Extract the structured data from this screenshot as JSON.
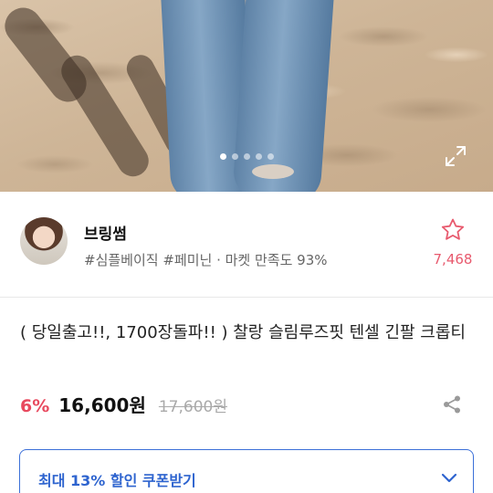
{
  "hero": {
    "image_alt": "",
    "carousel_dots": [
      true,
      false,
      false,
      false,
      false
    ],
    "expand_icon": "expand-icon"
  },
  "seller": {
    "name": "브링썸",
    "meta": "#심플베이직 #페미닌 · 마켓 만족도 93%",
    "favorite_count": "7,468",
    "favorite_icon": "star-outline-icon"
  },
  "product": {
    "title": "( 당일출고!!, 1700장돌파!! )  찰랑 슬림루즈핏 텐셀 긴팔 크롭티",
    "discount": "6%",
    "price": "16,600원",
    "original_price": "17,600원",
    "share_icon": "share-icon"
  },
  "coupon": {
    "label": "최대 13% 할인 쿠폰받기",
    "chevron_icon": "chevron-down-icon"
  },
  "colors": {
    "accent_pink": "#e84a5f",
    "accent_blue": "#2e64cf",
    "muted_text": "#666666"
  }
}
